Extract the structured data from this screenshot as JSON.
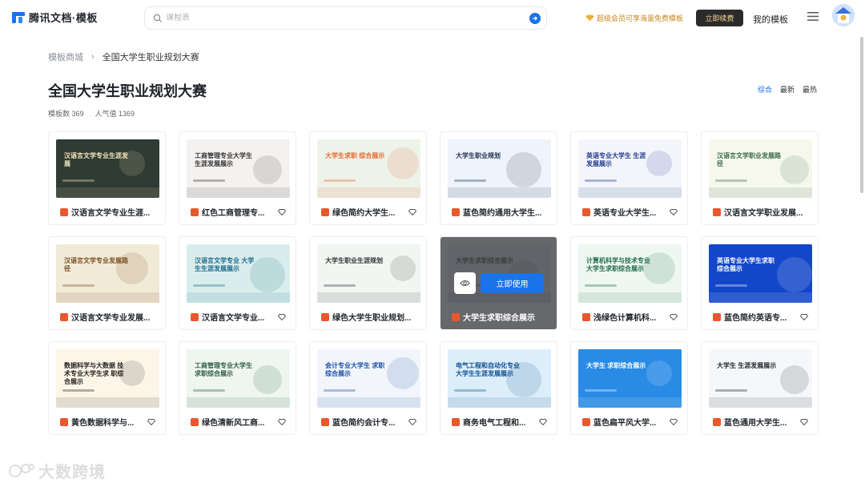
{
  "header": {
    "logo_text": "腾讯文档·模板",
    "search_placeholder": "课程表",
    "vip_text": "超级会员可享海量免费模板",
    "renew_label": "立即续费",
    "my_templates_label": "我的模板"
  },
  "breadcrumb": {
    "home": "模板商城",
    "separator": "›",
    "current": "全国大学生职业规划大赛"
  },
  "page": {
    "title": "全国大学生职业规划大赛",
    "template_count": "模板数 369",
    "popularity": "人气值 1369"
  },
  "sorts": [
    "综合",
    "最新",
    "最热"
  ],
  "hover": {
    "use_label": "立即使用"
  },
  "watermark": "大数跨境",
  "cards": [
    {
      "title": "汉语言文学专业生涯...",
      "thumb_text": "汉语言文学专业生涯发展",
      "bg": "#2f3b35",
      "fg": "#f4e7b8",
      "gem": false
    },
    {
      "title": "红色工商管理专...",
      "thumb_text": "工商管理专业大学生 生涯发展展示",
      "bg": "#f4f2f0",
      "fg": "#333",
      "gem": true
    },
    {
      "title": "绿色简约大学生...",
      "thumb_text": "大学生求职 综合展示",
      "bg": "#eef3ea",
      "fg": "#e46a2c",
      "gem": true
    },
    {
      "title": "蓝色简约通用大学生...",
      "thumb_text": "大学生职业规划",
      "bg": "#eef4fb",
      "fg": "#1f2d4d",
      "gem": false
    },
    {
      "title": "英语专业大学生...",
      "thumb_text": "英语专业大学生 生涯发展展示",
      "bg": "#f3f5fb",
      "fg": "#243b8c",
      "gem": true
    },
    {
      "title": "汉语言文学职业发展...",
      "thumb_text": "汉语言文学职业发展路径",
      "bg": "#f6f8ee",
      "fg": "#3a6b45",
      "gem": false
    },
    {
      "title": "汉语言文学专业发展...",
      "thumb_text": "汉语言文学专业发展路径",
      "bg": "#f1ead7",
      "fg": "#7a4e22",
      "gem": false
    },
    {
      "title": "汉语言文学专业...",
      "thumb_text": "汉语言文学专业 大学生生涯发展展示",
      "bg": "#d9eeec",
      "fg": "#1f6a8c",
      "gem": true
    },
    {
      "title": "绿色大学生职业规划...",
      "thumb_text": "大学生职业生涯规划",
      "bg": "#f2f6f3",
      "fg": "#333",
      "gem": false
    },
    {
      "title": "大学生求职综合展示",
      "thumb_text": "大学生求职综合展示",
      "bg": "#e9ecef",
      "fg": "#333",
      "gem": false,
      "hover": true
    },
    {
      "title": "浅绿色计算机科...",
      "thumb_text": "计算机科学与技术专业 大学生求职综合展示",
      "bg": "#eef7f1",
      "fg": "#1f6a4e",
      "gem": true
    },
    {
      "title": "蓝色简约英语专...",
      "thumb_text": "英语专业大学生求职 综合展示",
      "bg": "#1346c9",
      "fg": "#ffffff",
      "gem": true
    },
    {
      "title": "黄色数据科学与...",
      "thumb_text": "数据科学与大数据 技术专业大学生求 职综合展示",
      "bg": "#fdf6e8",
      "fg": "#222",
      "gem": true
    },
    {
      "title": "绿色清新风工商...",
      "thumb_text": "工商管理专业大学生 求职综合展示",
      "bg": "#eef6ef",
      "fg": "#2b5c3e",
      "gem": true
    },
    {
      "title": "蓝色简约会计专...",
      "thumb_text": "会计专业大学生 求职综合展示",
      "bg": "#f2f6fb",
      "fg": "#1a4fa8",
      "gem": true
    },
    {
      "title": "商务电气工程和...",
      "thumb_text": "电气工程和自动化专业 大学生生涯发展展示",
      "bg": "#dceefa",
      "fg": "#0e4f93",
      "gem": true
    },
    {
      "title": "蓝色扁平风大学...",
      "thumb_text": "大学生 求职综合展示",
      "bg": "#2a8be6",
      "fg": "#ffffff",
      "gem": true
    },
    {
      "title": "蓝色通用大学生...",
      "thumb_text": "大学生 生涯发展展示",
      "bg": "#f6f7fa",
      "fg": "#1f2329",
      "gem": true
    }
  ]
}
